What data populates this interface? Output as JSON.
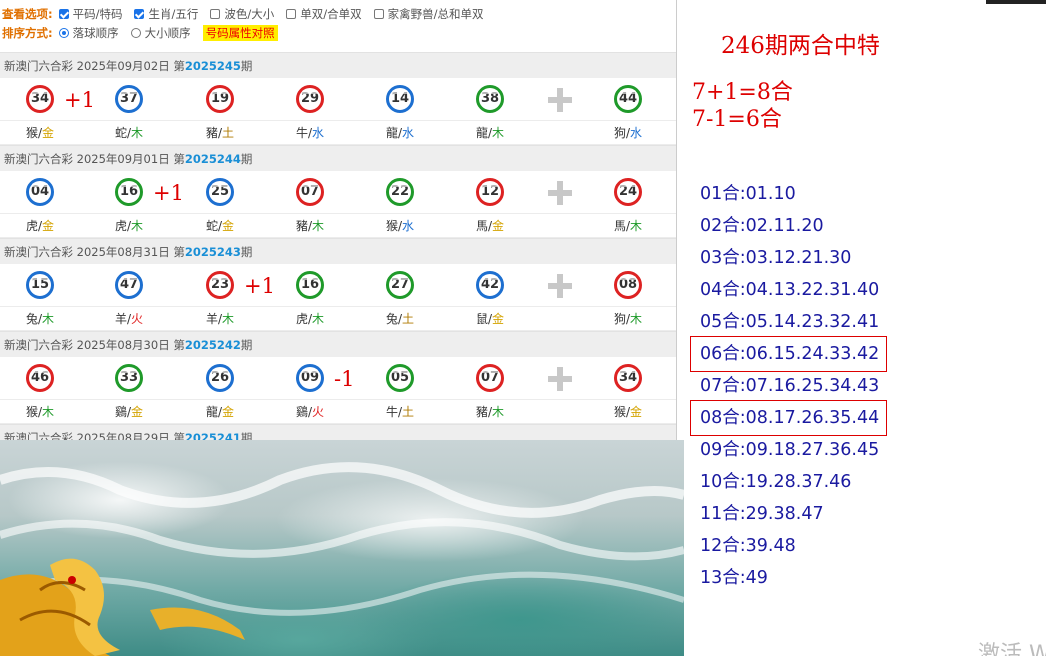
{
  "options": {
    "view_label": "查看选项:",
    "view_items": [
      {
        "label": "平码/特码",
        "checked": true
      },
      {
        "label": "生肖/五行",
        "checked": true
      },
      {
        "label": "波色/大小",
        "checked": false
      },
      {
        "label": "单双/合单双",
        "checked": false
      },
      {
        "label": "家禽野兽/总和单双",
        "checked": false
      }
    ],
    "sort_label": "排序方式:",
    "sort_items": [
      {
        "label": "落球顺序",
        "checked": true
      },
      {
        "label": "大小顺序",
        "checked": false
      }
    ],
    "attr_button": "号码属性对照"
  },
  "draws": [
    {
      "prefix": "新澳门六合彩 2025年09月02日 第",
      "issue": "2025245",
      "suffix": "期",
      "balls": [
        {
          "num": "34",
          "color": "red",
          "zodiac": "猴",
          "element": "金"
        },
        {
          "num": "37",
          "color": "blue",
          "zodiac": "蛇",
          "element": "木"
        },
        {
          "num": "19",
          "color": "red",
          "zodiac": "豬",
          "element": "土"
        },
        {
          "num": "29",
          "color": "red",
          "zodiac": "牛",
          "element": "水"
        },
        {
          "num": "14",
          "color": "blue",
          "zodiac": "龍",
          "element": "水"
        },
        {
          "num": "38",
          "color": "green",
          "zodiac": "龍",
          "element": "木"
        },
        {
          "num": "44",
          "color": "green",
          "zodiac": "狗",
          "element": "水"
        }
      ],
      "mark": {
        "text": "+1",
        "after": 0
      }
    },
    {
      "prefix": "新澳门六合彩 2025年09月01日 第",
      "issue": "2025244",
      "suffix": "期",
      "balls": [
        {
          "num": "04",
          "color": "blue",
          "zodiac": "虎",
          "element": "金"
        },
        {
          "num": "16",
          "color": "green",
          "zodiac": "虎",
          "element": "木"
        },
        {
          "num": "25",
          "color": "blue",
          "zodiac": "蛇",
          "element": "金"
        },
        {
          "num": "07",
          "color": "red",
          "zodiac": "豬",
          "element": "木"
        },
        {
          "num": "22",
          "color": "green",
          "zodiac": "猴",
          "element": "水"
        },
        {
          "num": "12",
          "color": "red",
          "zodiac": "馬",
          "element": "金"
        },
        {
          "num": "24",
          "color": "red",
          "zodiac": "馬",
          "element": "木"
        }
      ],
      "mark": {
        "text": "+1",
        "after": 1
      }
    },
    {
      "prefix": "新澳门六合彩 2025年08月31日 第",
      "issue": "2025243",
      "suffix": "期",
      "balls": [
        {
          "num": "15",
          "color": "blue",
          "zodiac": "兔",
          "element": "木"
        },
        {
          "num": "47",
          "color": "blue",
          "zodiac": "羊",
          "element": "火"
        },
        {
          "num": "23",
          "color": "red",
          "zodiac": "羊",
          "element": "木"
        },
        {
          "num": "16",
          "color": "green",
          "zodiac": "虎",
          "element": "木"
        },
        {
          "num": "27",
          "color": "green",
          "zodiac": "兔",
          "element": "土"
        },
        {
          "num": "42",
          "color": "blue",
          "zodiac": "鼠",
          "element": "金"
        },
        {
          "num": "08",
          "color": "red",
          "zodiac": "狗",
          "element": "木"
        }
      ],
      "mark": {
        "text": "+1",
        "after": 2
      }
    },
    {
      "prefix": "新澳门六合彩 2025年08月30日 第",
      "issue": "2025242",
      "suffix": "期",
      "balls": [
        {
          "num": "46",
          "color": "red",
          "zodiac": "猴",
          "element": "木"
        },
        {
          "num": "33",
          "color": "green",
          "zodiac": "鷄",
          "element": "金"
        },
        {
          "num": "26",
          "color": "blue",
          "zodiac": "龍",
          "element": "金"
        },
        {
          "num": "09",
          "color": "blue",
          "zodiac": "鷄",
          "element": "火"
        },
        {
          "num": "05",
          "color": "green",
          "zodiac": "牛",
          "element": "土"
        },
        {
          "num": "07",
          "color": "red",
          "zodiac": "豬",
          "element": "木"
        },
        {
          "num": "34",
          "color": "red",
          "zodiac": "猴",
          "element": "金"
        }
      ],
      "mark": {
        "text": "-1",
        "after": 3
      }
    }
  ],
  "partial_draw": {
    "prefix": "新澳门六合彩 2025年08月29日 第",
    "issue": "2025241",
    "suffix": "期"
  },
  "right": {
    "title": "246期两合中特",
    "formulas": [
      "7+1=8合",
      "7-1=6合"
    ],
    "combos": [
      "01合:01.10",
      "02合:02.11.20",
      "03合:03.12.21.30",
      "04合:04.13.22.31.40",
      "05合:05.14.23.32.41",
      "06合:06.15.24.33.42",
      "07合:07.16.25.34.43",
      "08合:08.17.26.35.44",
      "09合:09.18.27.36.45",
      "10合:19.28.37.46",
      "11合:29.38.47",
      "12合:39.48",
      "13合:49"
    ],
    "highlighted": [
      5,
      7
    ]
  },
  "watermark": "激活 W",
  "colors": {
    "red": "#dd2222",
    "blue": "#1d6fd0",
    "green": "#1f9a2a",
    "accent": "#dd0000",
    "combo_text": "#1a1aa0"
  }
}
